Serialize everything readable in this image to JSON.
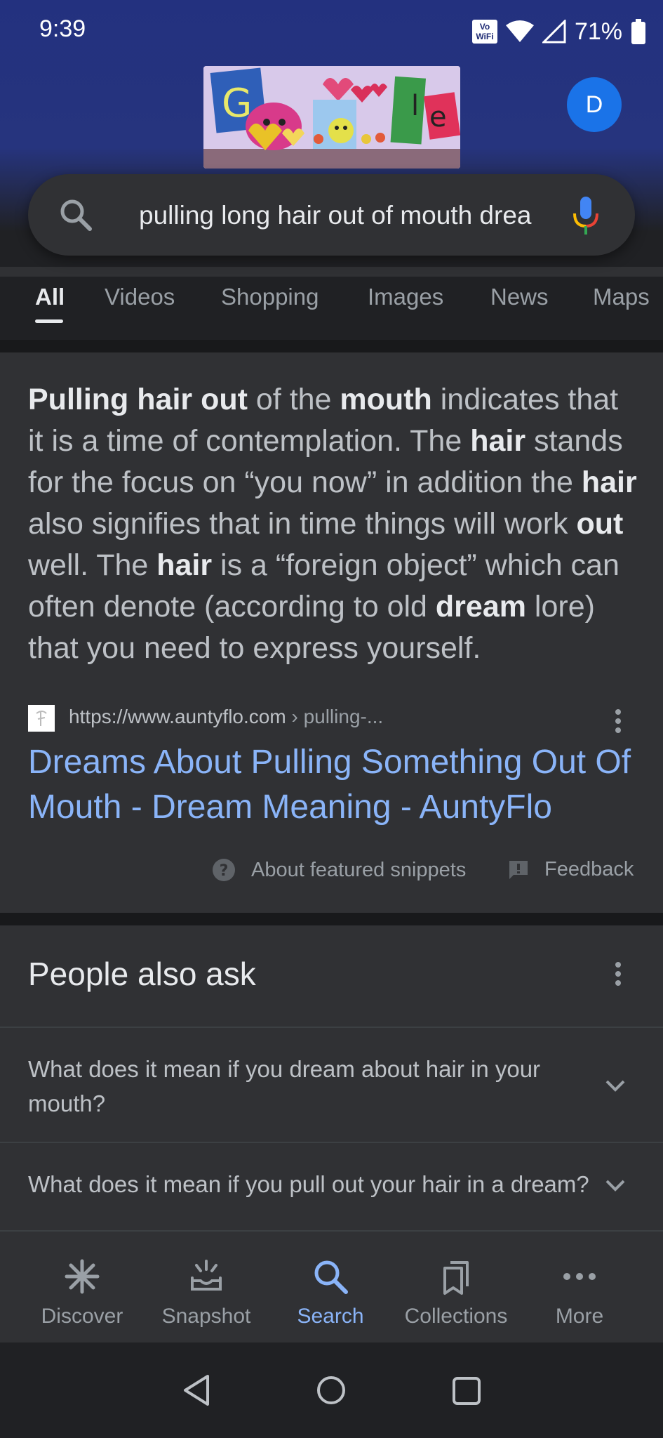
{
  "status_bar": {
    "time": "9:39",
    "wifi_badge_top": "Vo",
    "wifi_badge_bottom": "WiFi",
    "battery": "71%"
  },
  "header": {
    "avatar_letter": "D"
  },
  "search": {
    "query": "pulling long hair out of mouth dream"
  },
  "tabs": [
    {
      "label": "All",
      "active": true
    },
    {
      "label": "Videos"
    },
    {
      "label": "Shopping"
    },
    {
      "label": "Images"
    },
    {
      "label": "News"
    },
    {
      "label": "Maps"
    }
  ],
  "snippet": {
    "parts": [
      {
        "t": "Pulling hair out",
        "b": true
      },
      {
        "t": " of the "
      },
      {
        "t": "mouth",
        "b": true
      },
      {
        "t": " indicates that it is a time of contemplation. The "
      },
      {
        "t": "hair",
        "b": true
      },
      {
        "t": " stands for the focus on “you now” in addition the "
      },
      {
        "t": "hair",
        "b": true
      },
      {
        "t": " also signifies that in time things will work "
      },
      {
        "t": "out",
        "b": true
      },
      {
        "t": " well. The "
      },
      {
        "t": "hair",
        "b": true
      },
      {
        "t": " is a “foreign object” which can often denote (according to old "
      },
      {
        "t": "dream",
        "b": true
      },
      {
        "t": " lore) that you need to express yourself."
      }
    ],
    "source_domain": "https://www.auntyflo.com",
    "source_crumb": " › pulling-...",
    "title": "Dreams About Pulling Something Out Of Mouth - Dream Meaning - AuntyFlo",
    "about_label": "About featured snippets",
    "feedback_label": "Feedback"
  },
  "people_also_ask": {
    "title": "People also ask",
    "questions": [
      "What does it mean if you dream about hair in your mouth?",
      "What does it mean if you pull out your hair in a dream?"
    ]
  },
  "bottom_nav": [
    {
      "label": "Discover",
      "icon": "asterisk-icon"
    },
    {
      "label": "Snapshot",
      "icon": "snapshot-icon"
    },
    {
      "label": "Search",
      "icon": "search-icon",
      "active": true
    },
    {
      "label": "Collections",
      "icon": "bookmarks-icon"
    },
    {
      "label": "More",
      "icon": "more-horizontal-icon"
    }
  ],
  "colors": {
    "accent": "#8ab4f8",
    "avatar": "#1a73e8",
    "background": "#303134"
  }
}
